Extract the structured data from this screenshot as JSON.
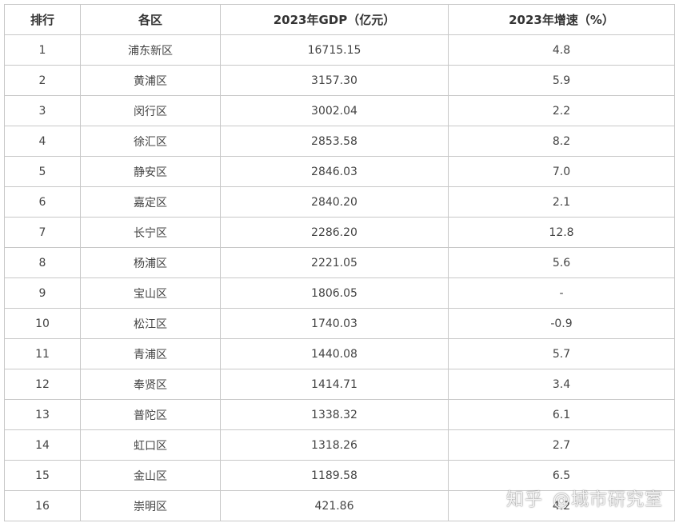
{
  "table": {
    "headers": [
      "排行",
      "各区",
      "2023年GDP（亿元）",
      "2023年增速（%）"
    ],
    "rows": [
      [
        "1",
        "浦东新区",
        "16715.15",
        "4.8"
      ],
      [
        "2",
        "黄浦区",
        "3157.30",
        "5.9"
      ],
      [
        "3",
        "闵行区",
        "3002.04",
        "2.2"
      ],
      [
        "4",
        "徐汇区",
        "2853.58",
        "8.2"
      ],
      [
        "5",
        "静安区",
        "2846.03",
        "7.0"
      ],
      [
        "6",
        "嘉定区",
        "2840.20",
        "2.1"
      ],
      [
        "7",
        "长宁区",
        "2286.20",
        "12.8"
      ],
      [
        "8",
        "杨浦区",
        "2221.05",
        "5.6"
      ],
      [
        "9",
        "宝山区",
        "1806.05",
        "-"
      ],
      [
        "10",
        "松江区",
        "1740.03",
        "-0.9"
      ],
      [
        "11",
        "青浦区",
        "1440.08",
        "5.7"
      ],
      [
        "12",
        "奉贤区",
        "1414.71",
        "3.4"
      ],
      [
        "13",
        "普陀区",
        "1338.32",
        "6.1"
      ],
      [
        "14",
        "虹口区",
        "1318.26",
        "2.7"
      ],
      [
        "15",
        "金山区",
        "1189.58",
        "6.5"
      ],
      [
        "16",
        "崇明区",
        "421.86",
        "4.2"
      ]
    ]
  },
  "watermark": {
    "brand": "知乎",
    "author": "@城市研究室"
  }
}
